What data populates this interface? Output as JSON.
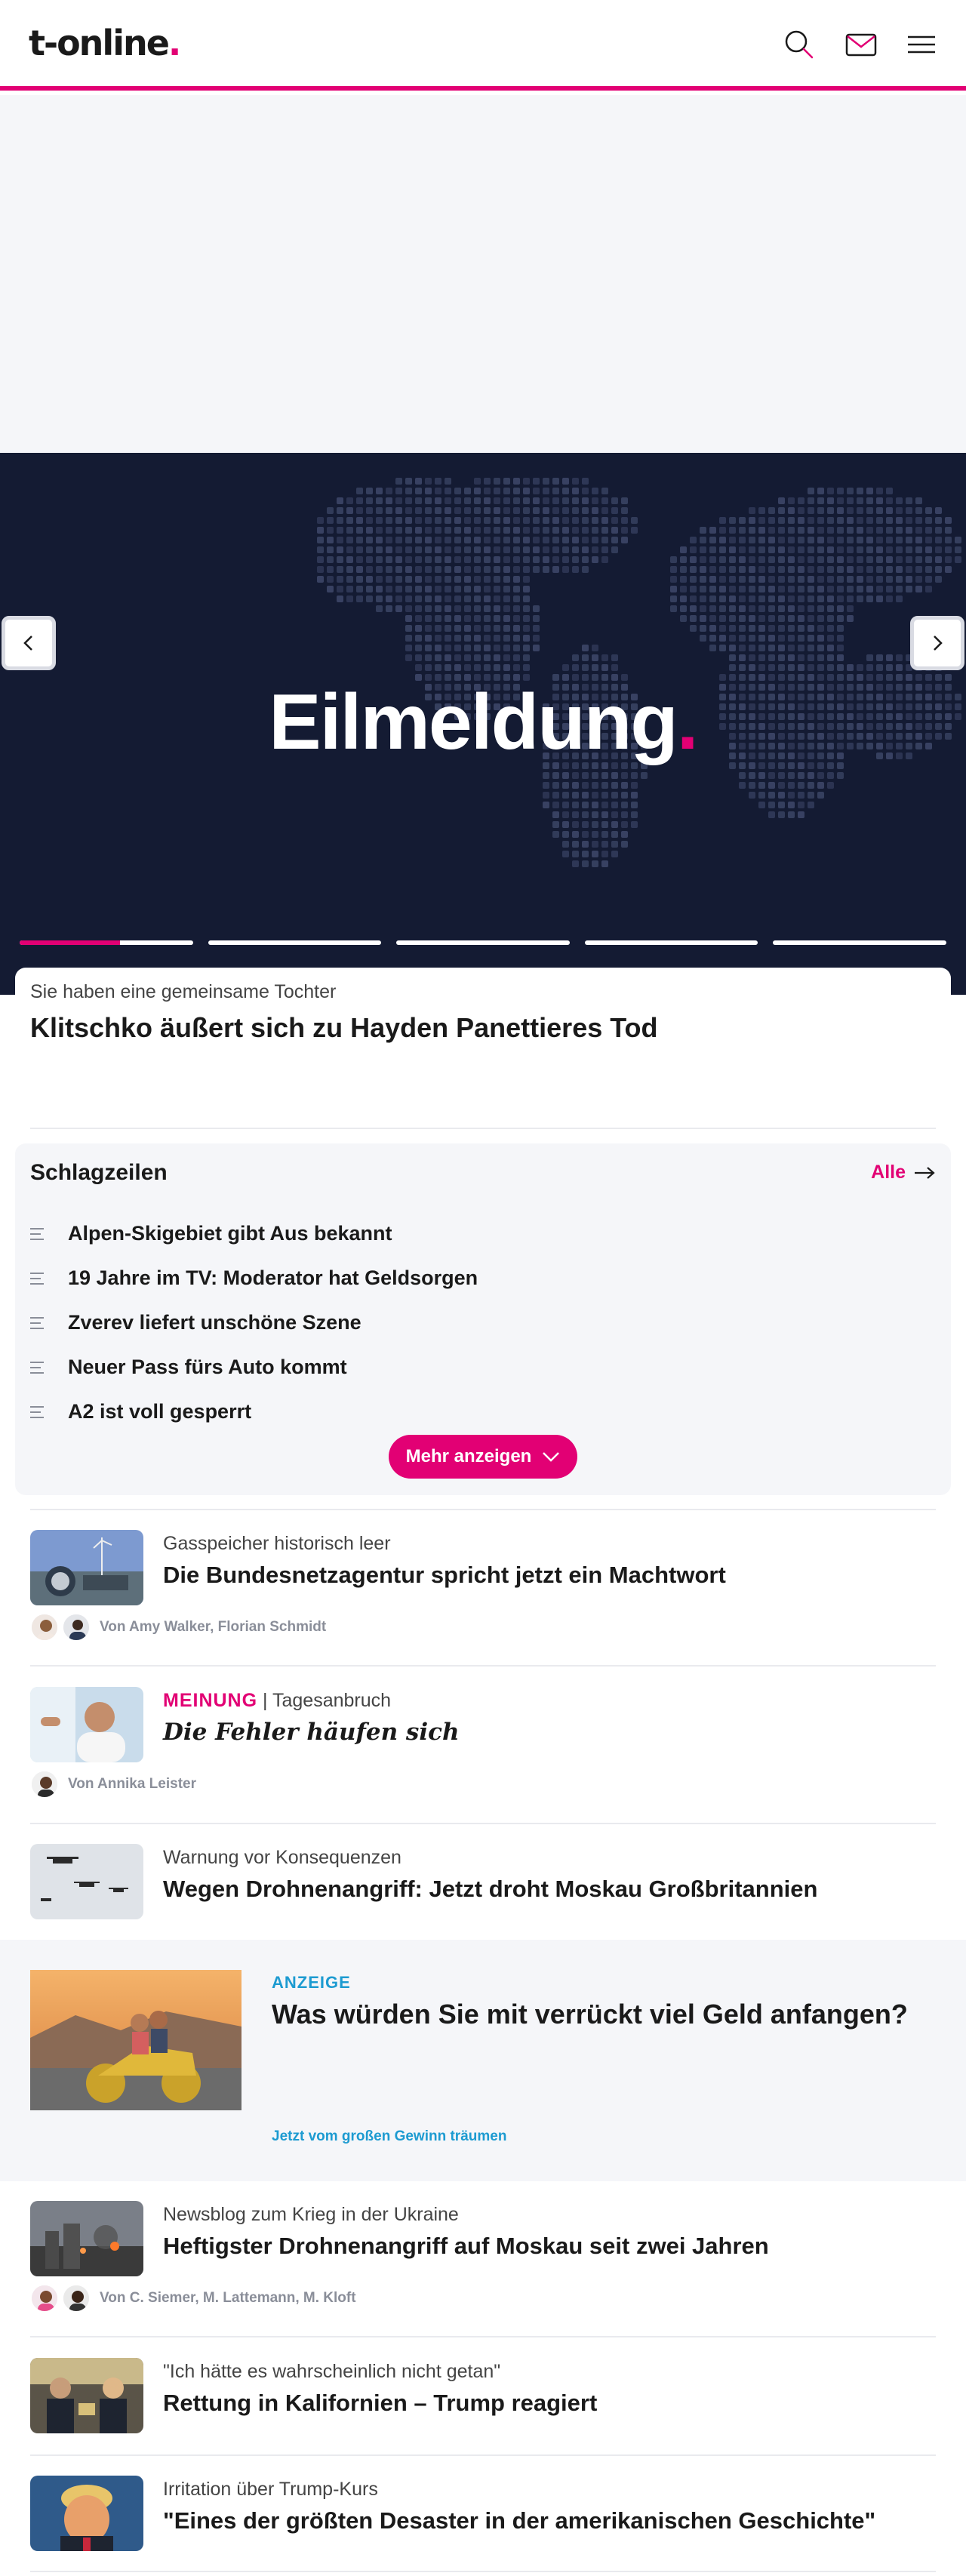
{
  "header": {
    "logo_text": "t-online",
    "logo_dot": ".",
    "icons": [
      "search-icon",
      "mail-icon",
      "menu-icon"
    ],
    "accent_color": "#e20074"
  },
  "hero": {
    "title": "Eilmeldung",
    "title_dot": ".",
    "background_color": "#141b33",
    "slide_count": 5,
    "active_slide": 1,
    "active_progress": 0.58,
    "card": {
      "kicker": "Sie haben eine gemeinsame Tochter",
      "headline": "Klitschko äußert sich zu Hayden Panettieres Tod"
    }
  },
  "schlagzeilen": {
    "title": "Schlagzeilen",
    "all_label": "Alle",
    "items": [
      "Alpen-Skigebiet gibt Aus bekannt",
      "19 Jahre im TV: Moderator hat Geldsorgen",
      "Zverev liefert unschöne Szene",
      "Neuer Pass fürs Auto kommt",
      "A2 ist voll gesperrt"
    ],
    "more_label": "Mehr anzeigen"
  },
  "articles": [
    {
      "kicker": "Gasspeicher historisch leer",
      "headline": "Die Bundesnetzagentur spricht jetzt ein Machtwort",
      "authors": "Von Amy Walker, Florian Schmidt"
    },
    {
      "opinion_label": "MEINUNG",
      "kicker_sep": " | ",
      "kicker": "Tagesanbruch",
      "headline": "Die Fehler häufen sich",
      "authors": "Von Annika Leister"
    },
    {
      "kicker": "Warnung vor Konsequenzen",
      "headline": "Wegen Drohnenangriff: Jetzt droht Moskau Großbritannien"
    }
  ],
  "ad": {
    "label": "ANZEIGE",
    "headline": "Was würden Sie mit verrückt viel Geld anfangen?",
    "link": "Jetzt vom großen Gewinn träumen"
  },
  "articles2": [
    {
      "kicker": "Newsblog zum Krieg in der Ukraine",
      "headline": "Heftigster Drohnenangriff auf Moskau seit zwei Jahren",
      "authors": "Von C. Siemer, M. Lattemann, M. Kloft"
    },
    {
      "kicker": "\"Ich hätte es wahrscheinlich nicht getan\"",
      "headline": "Rettung in Kalifornien – Trump reagiert"
    },
    {
      "kicker": "Irritation über Trump-Kurs",
      "headline": "\"Eines der größten Desaster in der amerikanischen Geschichte\""
    }
  ]
}
